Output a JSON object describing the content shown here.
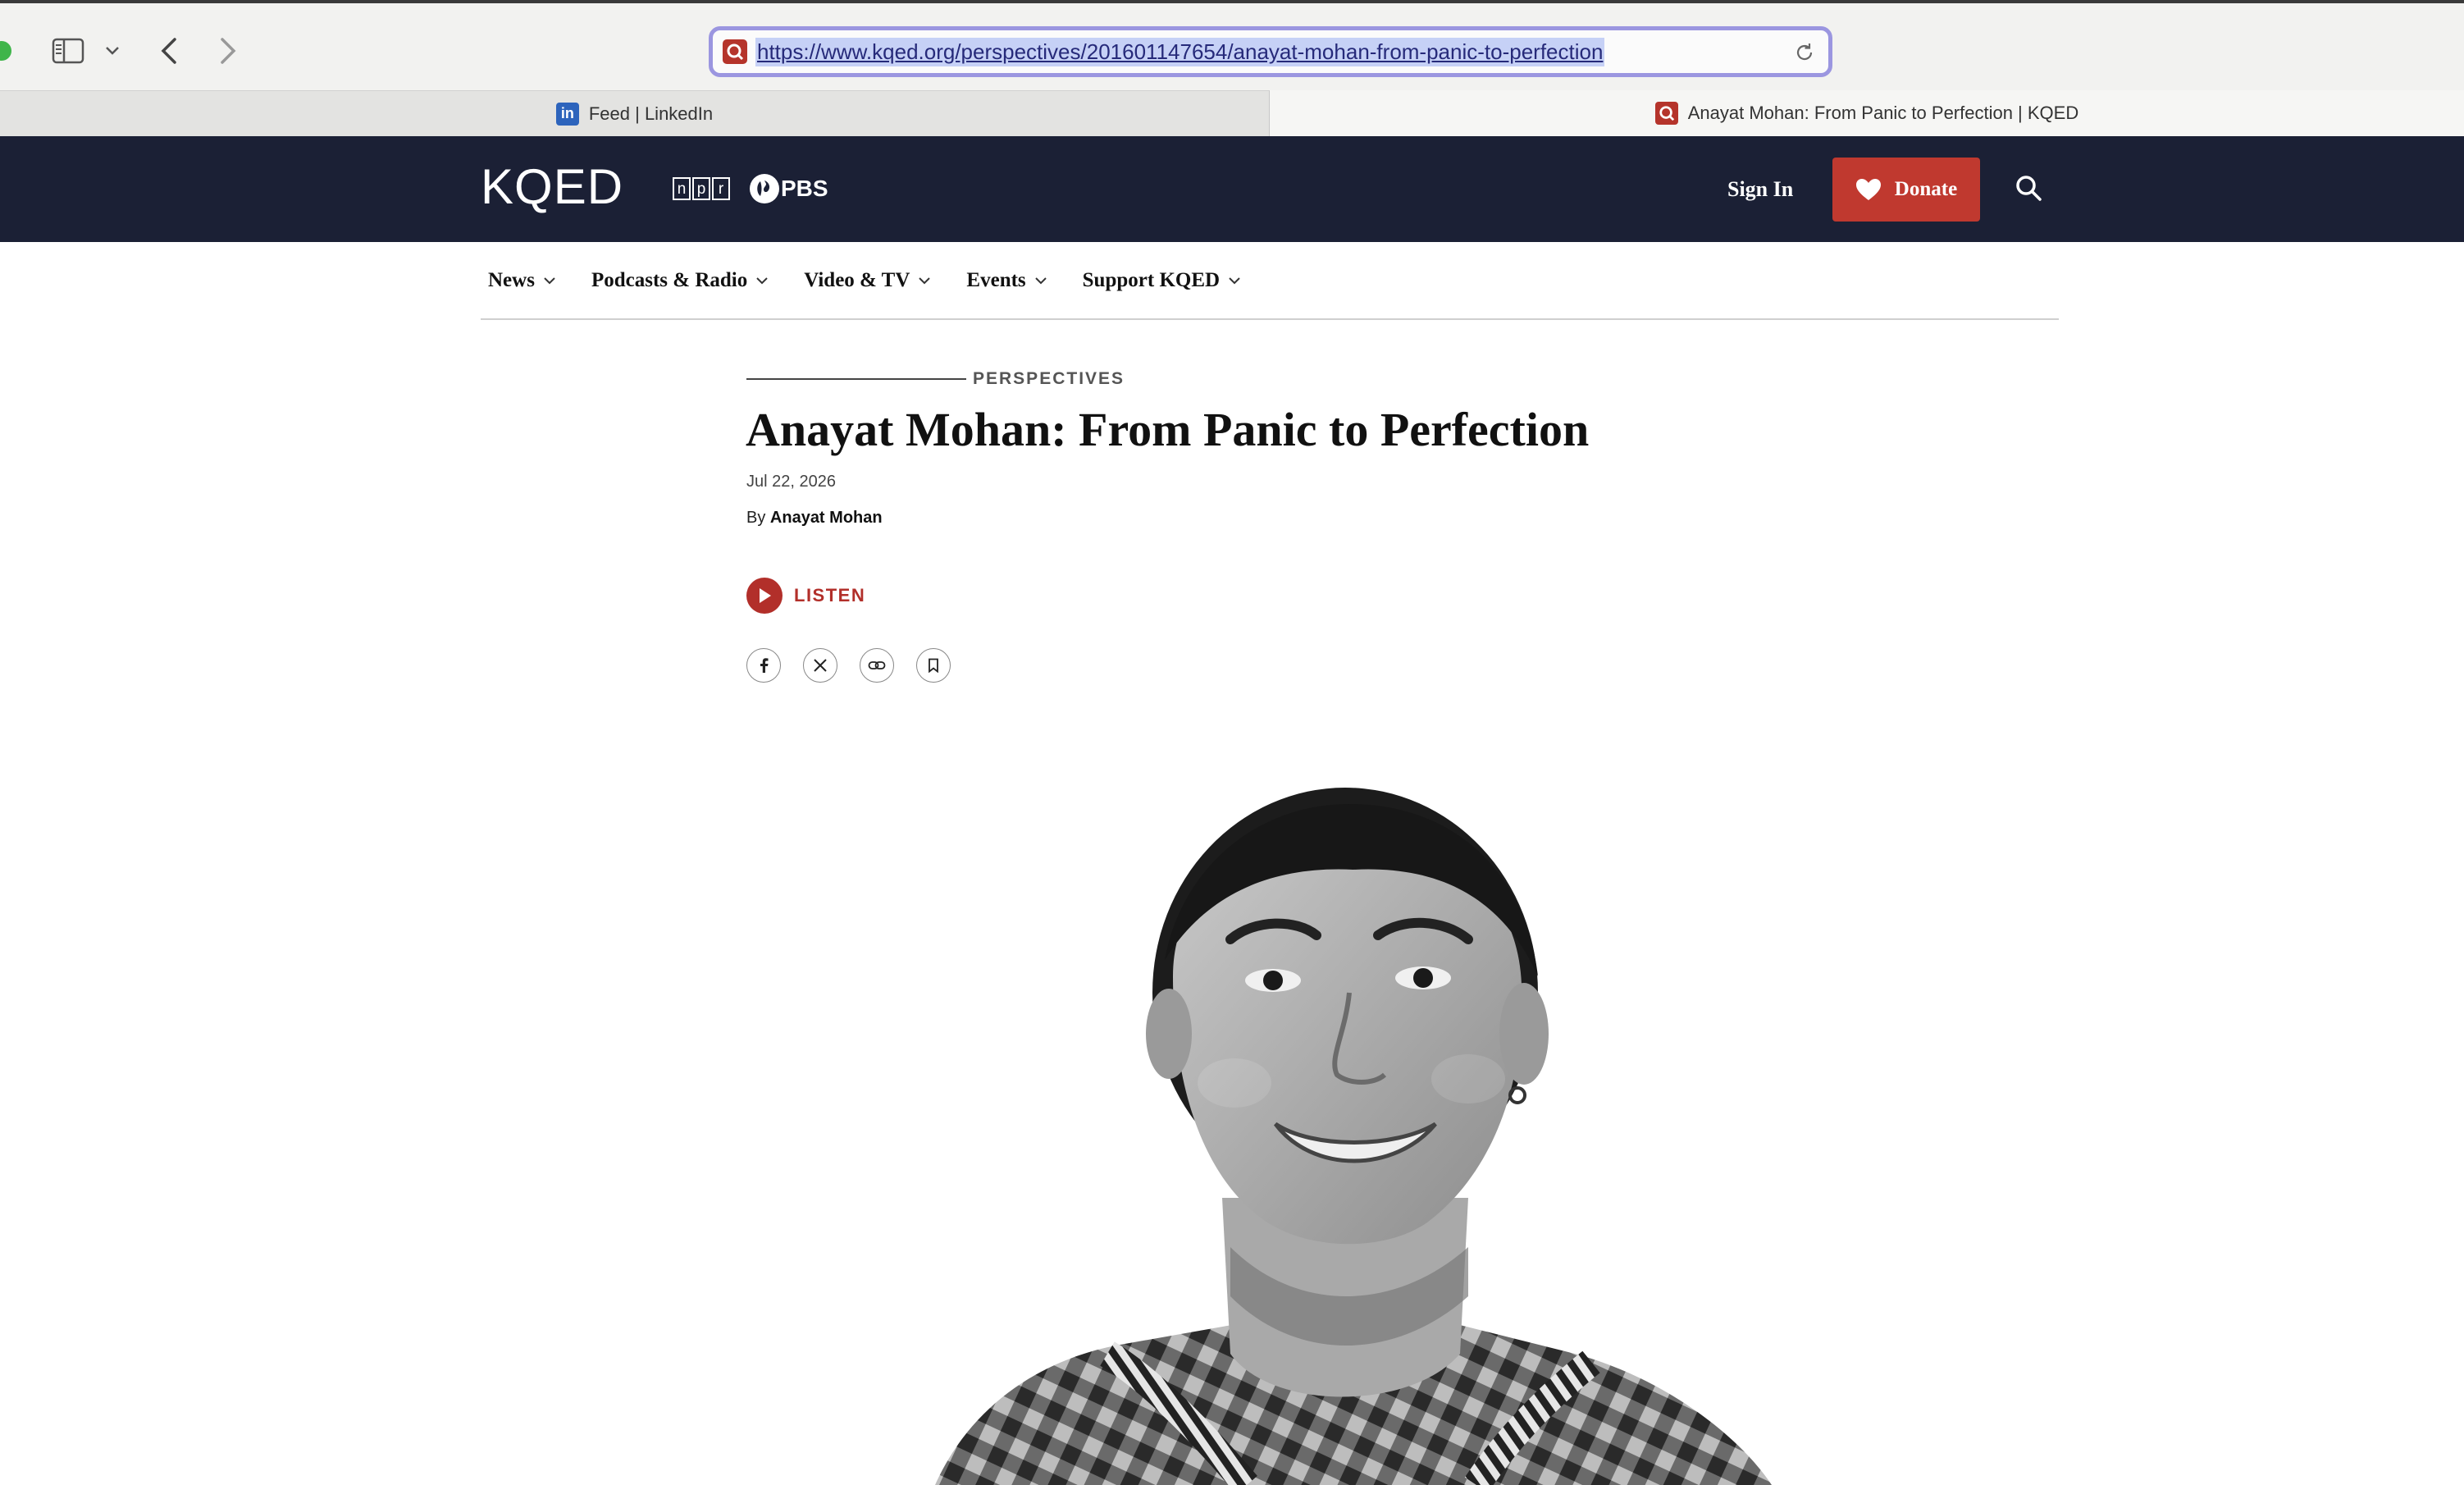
{
  "browser": {
    "url": "https://www.kqed.org/perspectives/201601147654/anayat-mohan-from-panic-to-perfection",
    "tabs": [
      {
        "title": "Feed | LinkedIn",
        "active": false
      },
      {
        "title": "Anayat Mohan: From Panic to Perfection | KQED",
        "active": true
      }
    ]
  },
  "header": {
    "logo": "KQED",
    "npr_letters": [
      "n",
      "p",
      "r"
    ],
    "pbs": "PBS",
    "sign_in": "Sign In",
    "donate": "Donate"
  },
  "nav": {
    "items": [
      {
        "label": "News"
      },
      {
        "label": "Podcasts & Radio"
      },
      {
        "label": "Video & TV"
      },
      {
        "label": "Events"
      },
      {
        "label": "Support KQED"
      }
    ]
  },
  "article": {
    "section": "PERSPECTIVES",
    "title": "Anayat Mohan: From Panic to Perfection",
    "date": "Jul 22, 2026",
    "by_prefix": "By",
    "author": "Anayat Mohan",
    "listen_label": "LISTEN",
    "share_icons": [
      "facebook-icon",
      "x-icon",
      "link-icon",
      "bookmark-icon"
    ]
  },
  "colors": {
    "header_bg": "#1b2035",
    "donate_bg": "#c0392f",
    "listen_red": "#b22f2a",
    "url_selection": "#c6d1f6"
  }
}
